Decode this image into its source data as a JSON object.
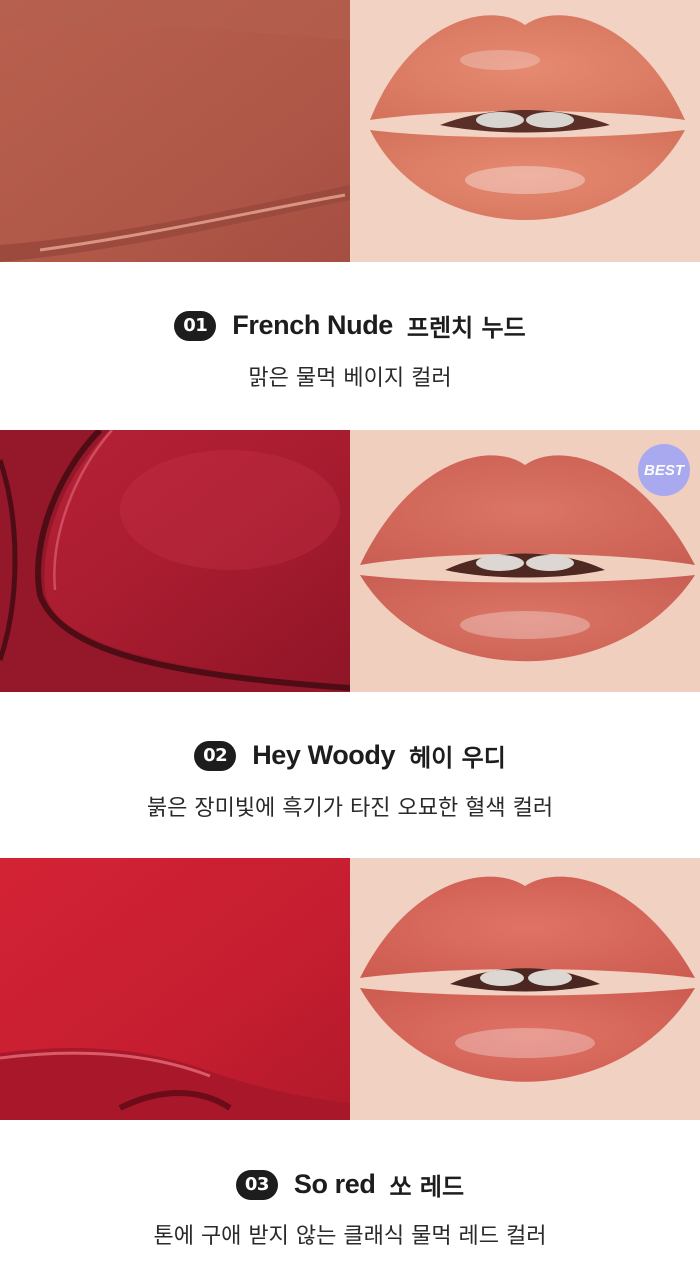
{
  "shades": [
    {
      "number": "01",
      "name_en": "French Nude",
      "name_ko": "프렌치 누드",
      "description": "맑은 물먹 베이지 컬러",
      "swatch_color": "#b55a4c",
      "lip_color": "#e0826a",
      "badge": null
    },
    {
      "number": "02",
      "name_en": "Hey Woody",
      "name_ko": "헤이 우디",
      "description": "붉은 장미빛에 흑기가 타진 오묘한 혈색 컬러",
      "swatch_color": "#b01f34",
      "lip_color": "#d2695e",
      "badge": "BEST"
    },
    {
      "number": "03",
      "name_en": "So red",
      "name_ko": "쏘 레드",
      "description": "톤에 구애 받지 않는 클래식 물먹 레드 컬러",
      "swatch_color": "#c81e2f",
      "lip_color": "#d9675a",
      "badge": null
    }
  ]
}
